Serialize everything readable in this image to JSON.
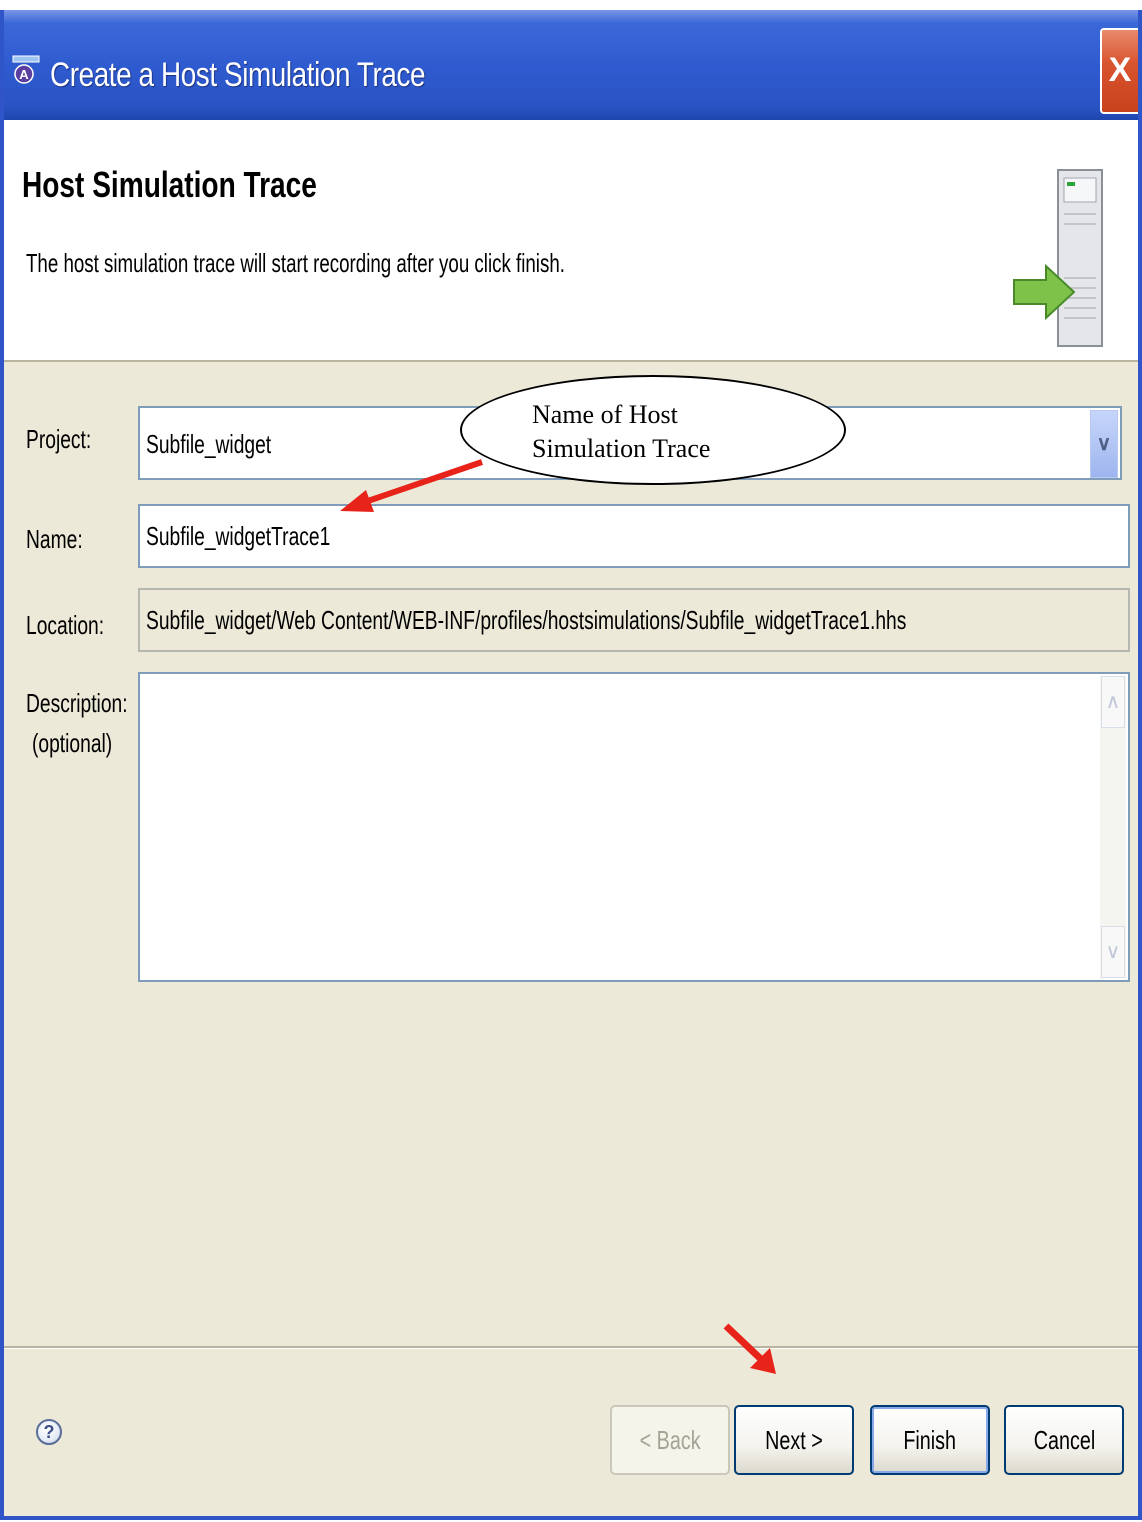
{
  "window": {
    "title": "Create a Host Simulation Trace",
    "close_label": "X"
  },
  "banner": {
    "title": "Host Simulation Trace",
    "description": "The host simulation trace will start recording after you click finish."
  },
  "form": {
    "project_label": "Project:",
    "project_value": "Subfile_widget",
    "name_label": "Name:",
    "name_value": "Subfile_widgetTrace1",
    "location_label": "Location:",
    "location_value": "Subfile_widget/Web Content/WEB-INF/profiles/hostsimulations/Subfile_widgetTrace1.hhs",
    "description_label": "Description:",
    "description_sublabel": "(optional)",
    "description_value": ""
  },
  "buttons": {
    "help": "?",
    "back": "< Back",
    "next": "Next >",
    "finish": "Finish",
    "cancel": "Cancel"
  },
  "annotation": {
    "callout_line1": "Name of Host",
    "callout_line2": "Simulation Trace",
    "arrow_color": "#e8231a"
  },
  "colors": {
    "titlebar": "#2f5bd0",
    "dialog_bg": "#ece9d8",
    "field_border": "#7f9db9"
  }
}
